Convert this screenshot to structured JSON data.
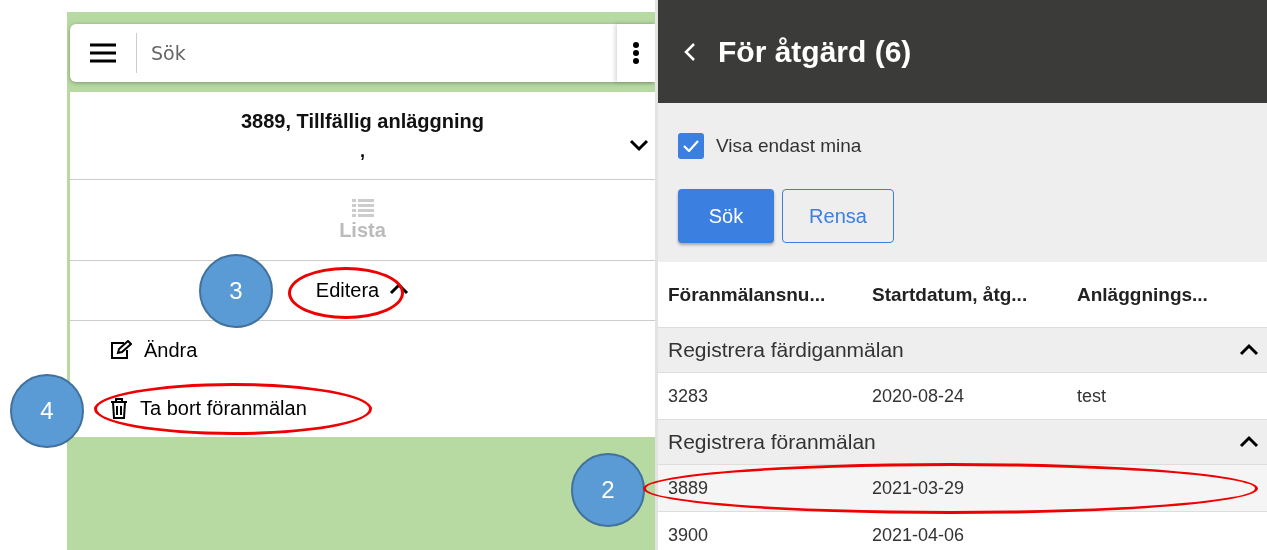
{
  "search_bar": {
    "placeholder": "Sök"
  },
  "record_panel": {
    "title": "3889, Tillfällig anläggning",
    "subtitle": ",",
    "expanded": false,
    "sections": [
      {
        "kind": "tab",
        "label": "Lista",
        "disabled": true
      },
      {
        "kind": "toggle",
        "label": "Editera",
        "expanded": true
      }
    ],
    "menu": [
      {
        "kind": "edit",
        "label": "Ändra"
      },
      {
        "kind": "delete",
        "label": "Ta bort föranmälan"
      }
    ]
  },
  "action_panel": {
    "title": "För åtgärd (6)",
    "filter": {
      "label": "Visa endast mina",
      "checked": true
    },
    "buttons": [
      {
        "kind": "primary",
        "label": "Sök"
      },
      {
        "kind": "secondary",
        "label": "Rensa"
      }
    ],
    "table": {
      "columns": [
        "Föranmälansnu...",
        "Startdatum, åtg...",
        "Anläggnings..."
      ],
      "groups": [
        {
          "title": "Registrera färdiganmälan",
          "expanded": true,
          "rows": [
            {
              "cells": [
                "3283",
                "2020-08-24",
                "test"
              ],
              "selected": false
            }
          ]
        },
        {
          "title": "Registrera föranmälan",
          "expanded": true,
          "rows": [
            {
              "cells": [
                "3889",
                "2021-03-29",
                ""
              ],
              "selected": true
            },
            {
              "cells": [
                "3900",
                "2021-04-06",
                ""
              ],
              "selected": false
            }
          ]
        }
      ]
    }
  },
  "annotations": [
    {
      "kind": "callout",
      "label": "3"
    },
    {
      "kind": "callout",
      "label": "4"
    },
    {
      "kind": "callout",
      "label": "2"
    },
    {
      "kind": "highlight"
    },
    {
      "kind": "highlight"
    },
    {
      "kind": "highlight"
    }
  ]
}
